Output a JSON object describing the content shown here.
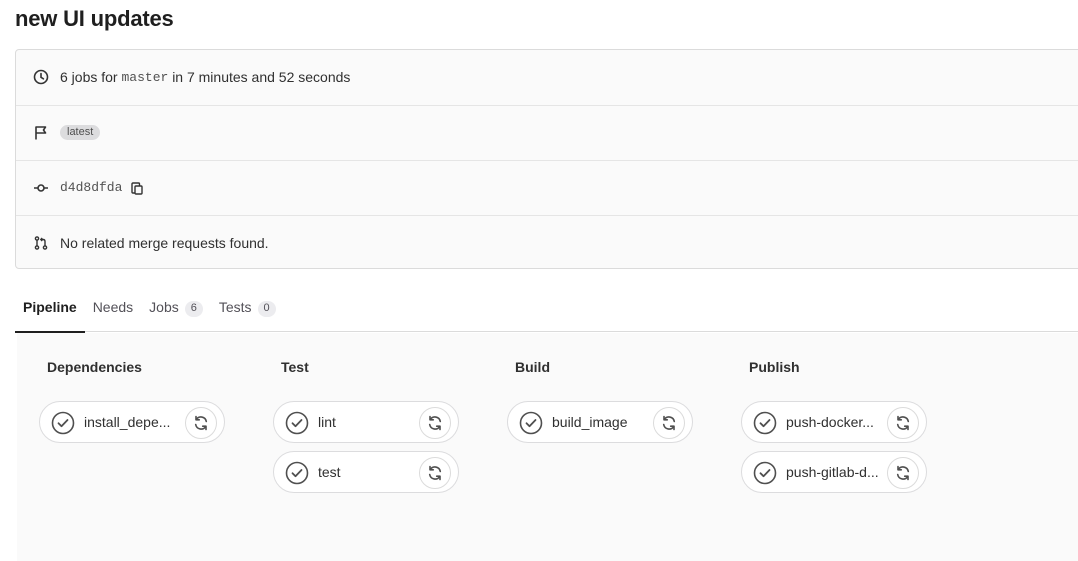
{
  "title": "new UI updates",
  "summary": {
    "jobs_prefix": "6 jobs for",
    "branch": "master",
    "duration_text": "in 7 minutes and 52 seconds",
    "badge_latest": "latest",
    "commit_sha": "d4d8dfda",
    "merge_requests_text": "No related merge requests found."
  },
  "icons": {
    "clock": "clock-icon",
    "flag": "flag-icon",
    "commit": "commit-icon",
    "copy": "copy-icon",
    "merge_request": "merge-request-icon",
    "status_success": "status-success-icon",
    "retry": "retry-icon"
  },
  "tabs": [
    {
      "label": "Pipeline",
      "active": true
    },
    {
      "label": "Needs"
    },
    {
      "label": "Jobs",
      "count": "6"
    },
    {
      "label": "Tests",
      "count": "0"
    }
  ],
  "stages": [
    {
      "name": "Dependencies",
      "jobs": [
        {
          "name": "install_depe..."
        }
      ]
    },
    {
      "name": "Test",
      "jobs": [
        {
          "name": "lint"
        },
        {
          "name": "test"
        }
      ]
    },
    {
      "name": "Build",
      "jobs": [
        {
          "name": "build_image"
        }
      ]
    },
    {
      "name": "Publish",
      "jobs": [
        {
          "name": "push-docker..."
        },
        {
          "name": "push-gitlab-d..."
        }
      ]
    }
  ],
  "colors": {
    "success": "#4f4f4f",
    "border": "#dbdbdb",
    "graph_bg": "#fafafa"
  }
}
